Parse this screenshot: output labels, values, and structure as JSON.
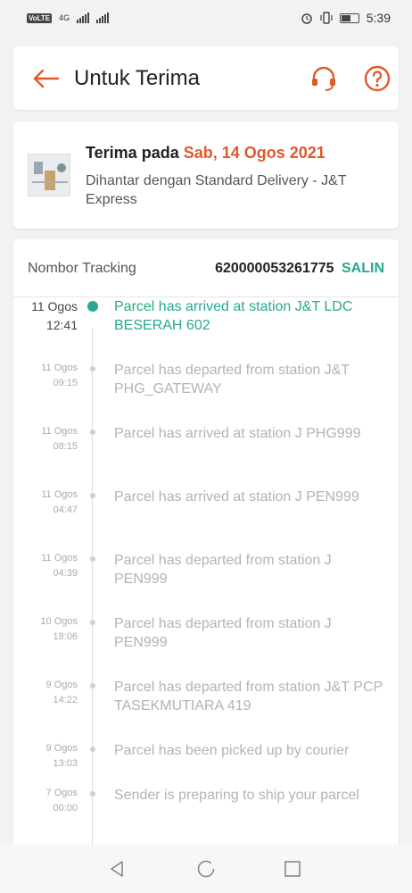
{
  "status_bar": {
    "carrier_badge": "VoLTE",
    "network": "4G",
    "time": "5:39"
  },
  "header": {
    "title": "Untuk Terima",
    "icons": [
      "back-arrow-icon",
      "headset-icon",
      "help-icon"
    ]
  },
  "delivery": {
    "received_label": "Terima pada",
    "received_date": "Sab, 14 Ogos 2021",
    "carrier_text": "Dihantar dengan Standard Delivery  - J&T Express"
  },
  "tracking": {
    "label": "Nombor Tracking",
    "number": "620000053261775",
    "copy_label": "SALIN"
  },
  "events": [
    {
      "date": "11 Ogos",
      "time": "12:41",
      "text": "Parcel has arrived at station J&T LDC BESERAH 602",
      "active": true
    },
    {
      "date": "11 Ogos",
      "time": "09:15",
      "text": "Parcel has departed from station J&T PHG_GATEWAY",
      "active": false
    },
    {
      "date": "11 Ogos",
      "time": "08:15",
      "text": "Parcel has arrived at station J PHG999",
      "active": false
    },
    {
      "date": "11 Ogos",
      "time": "04:47",
      "text": "Parcel has arrived at station J PEN999",
      "active": false
    },
    {
      "date": "11 Ogos",
      "time": "04:39",
      "text": "Parcel has departed from station J PEN999",
      "active": false
    },
    {
      "date": "10 Ogos",
      "time": "18:06",
      "text": "Parcel has departed from station J PEN999",
      "active": false
    },
    {
      "date": "9 Ogos",
      "time": "14:22",
      "text": "Parcel has departed from station J&T PCP TASEKMUTIARA 419",
      "active": false
    },
    {
      "date": "9 Ogos",
      "time": "13:03",
      "text": "Parcel has been picked up by courier",
      "active": false
    },
    {
      "date": "7 Ogos",
      "time": "00:00",
      "text": "Sender is preparing to ship your parcel",
      "active": false
    }
  ],
  "colors": {
    "accent": "#e0592a",
    "success": "#26a98c",
    "muted": "#b3b3b3"
  }
}
